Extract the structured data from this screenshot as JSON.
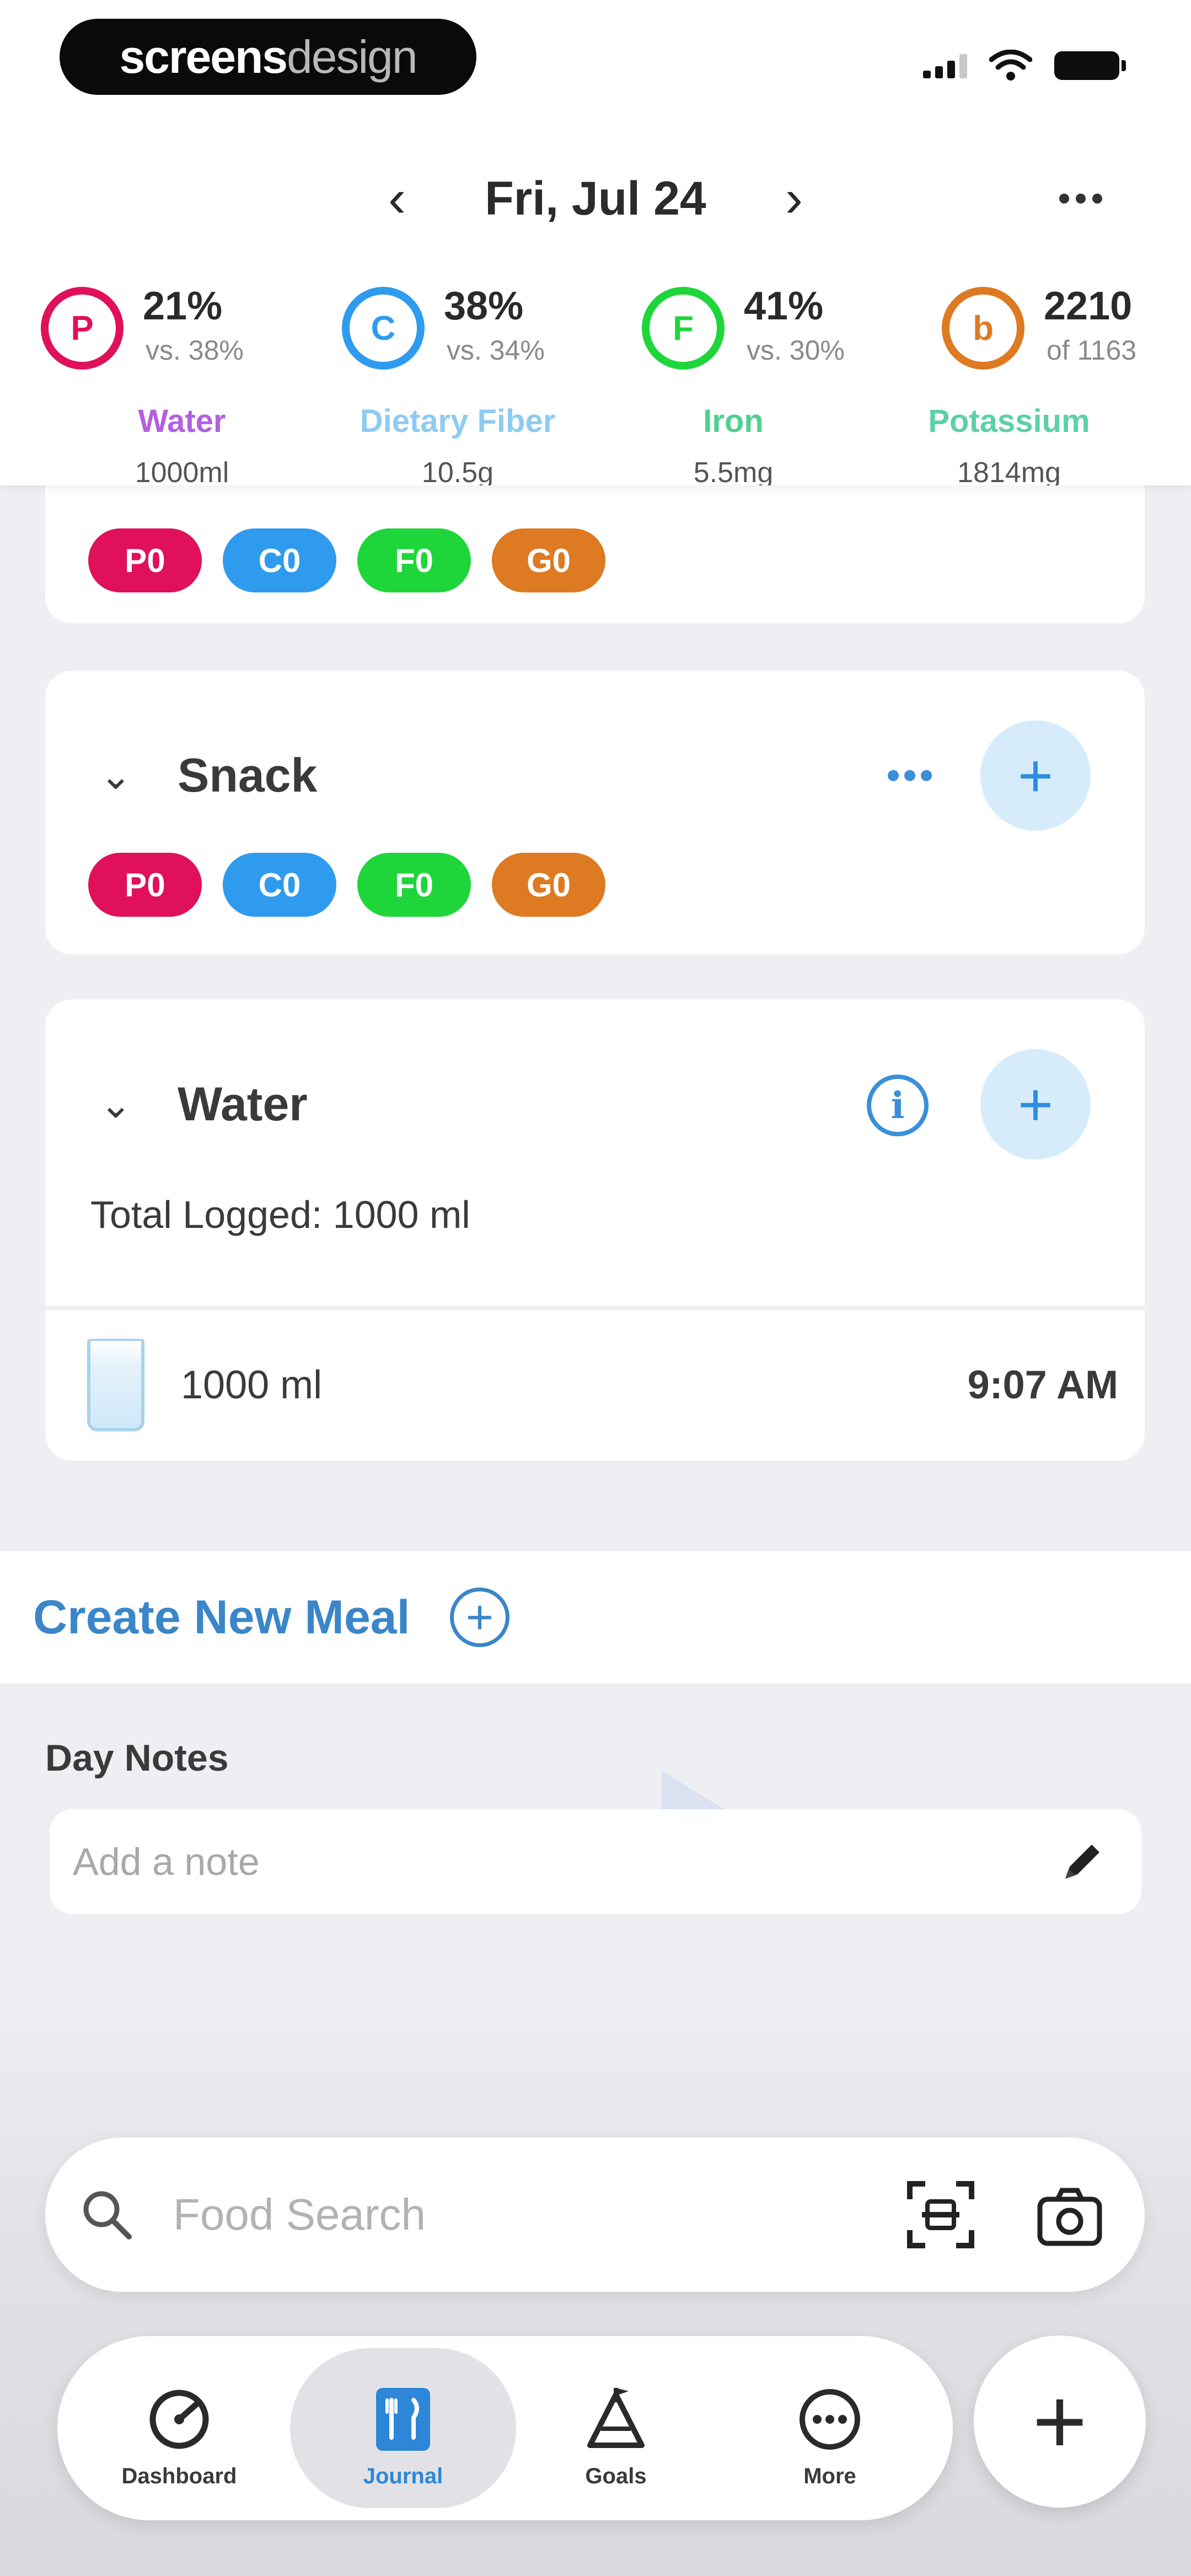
{
  "brand": {
    "part1": "screens",
    "part2": "design"
  },
  "header": {
    "date": "Fri, Jul 24",
    "prev_glyph": "‹",
    "next_glyph": "›"
  },
  "macros": [
    {
      "letter": "P",
      "pct": "21%",
      "vs": "vs. 38%",
      "color": "#e0105a"
    },
    {
      "letter": "C",
      "pct": "38%",
      "vs": "vs. 34%",
      "color": "#2f9bef"
    },
    {
      "letter": "F",
      "pct": "41%",
      "vs": "vs. 30%",
      "color": "#1ed63a"
    },
    {
      "letter": "b",
      "pct": "2210",
      "vs": "of 1163",
      "color": "#de7a22"
    }
  ],
  "nutrients": [
    {
      "name": "Water",
      "value": "1000ml",
      "color": "#b45fe0"
    },
    {
      "name": "Dietary Fiber",
      "value": "10.5g",
      "color": "#8ecbf2"
    },
    {
      "name": "Iron",
      "value": "5.5mg",
      "color": "#4fd08e"
    },
    {
      "name": "Potassium",
      "value": "1814mg",
      "color": "#5cd0a8"
    }
  ],
  "chips": {
    "p": "P0",
    "c": "C0",
    "f": "F0",
    "g": "G0"
  },
  "meals": {
    "snack": {
      "title": "Snack",
      "chev": "⌄",
      "add": "+"
    },
    "water": {
      "title": "Water",
      "chev": "⌄",
      "info": "i",
      "add": "+",
      "total_logged": "Total Logged: 1000 ml",
      "entry_amount": "1000 ml",
      "entry_time": "9:07 AM"
    }
  },
  "create_meal": {
    "label": "Create New Meal",
    "icon": "+"
  },
  "day_notes": {
    "title": "Day Notes",
    "placeholder": "Add a note"
  },
  "search": {
    "placeholder": "Food Search"
  },
  "tabs": [
    {
      "label": "Dashboard",
      "icon": "dashboard-icon",
      "active": false
    },
    {
      "label": "Journal",
      "icon": "journal-icon",
      "active": true
    },
    {
      "label": "Goals",
      "icon": "goals-icon",
      "active": false
    },
    {
      "label": "More",
      "icon": "more-icon",
      "active": false
    }
  ],
  "fab": {
    "label": "+"
  },
  "colors": {
    "accent": "#2d86d8",
    "protein": "#e0105a",
    "carbs": "#2f9bef",
    "fat": "#1ed63a",
    "other": "#de7a22"
  }
}
